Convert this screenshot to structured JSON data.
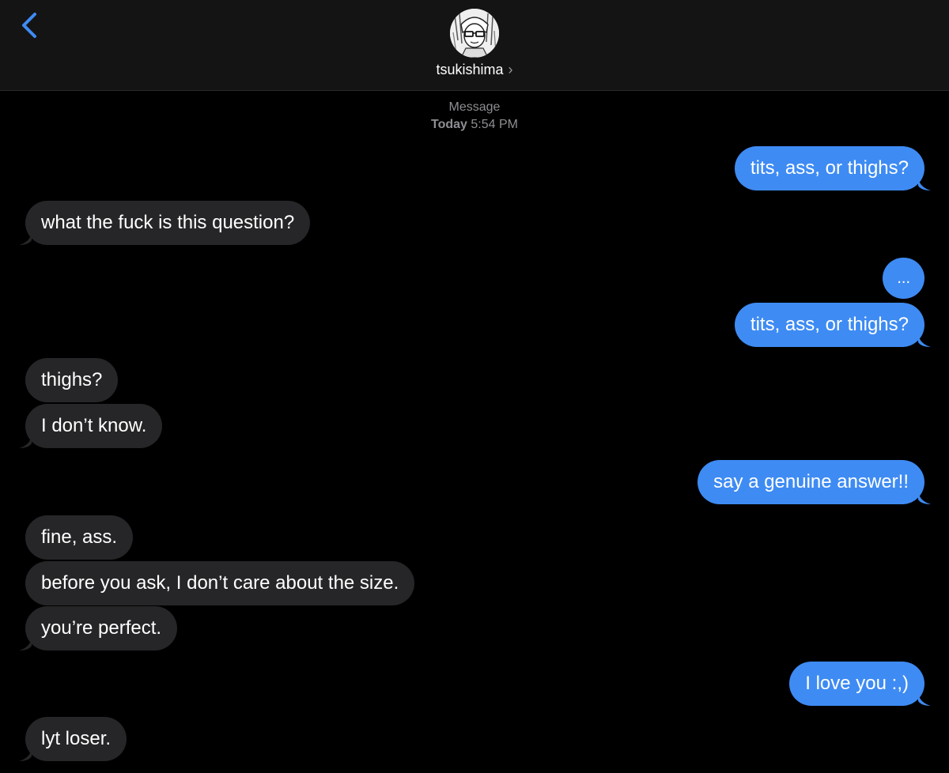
{
  "header": {
    "back_icon": "chevron-left-icon",
    "contact_name": "tsukishima",
    "chevron": "›",
    "accent_color": "#3e8bf3"
  },
  "meta": {
    "service": "Message",
    "day": "Today",
    "time": "5:54 PM"
  },
  "messages": [
    {
      "sender": "me",
      "text": "tits, ass, or thighs?"
    },
    {
      "sender": "them",
      "text": "what the fuck is this question?"
    },
    {
      "sender": "me",
      "text": "..."
    },
    {
      "sender": "me",
      "text": "tits, ass, or thighs?"
    },
    {
      "sender": "them",
      "text": "thighs?"
    },
    {
      "sender": "them",
      "text": "I don’t know."
    },
    {
      "sender": "me",
      "text": "say a genuine answer!!"
    },
    {
      "sender": "them",
      "text": "fine, ass."
    },
    {
      "sender": "them",
      "text": "before you ask, I don’t care about the size."
    },
    {
      "sender": "them",
      "text": "you’re perfect."
    },
    {
      "sender": "me",
      "text": "I love you :,)"
    },
    {
      "sender": "them",
      "text": "lyt loser."
    }
  ]
}
